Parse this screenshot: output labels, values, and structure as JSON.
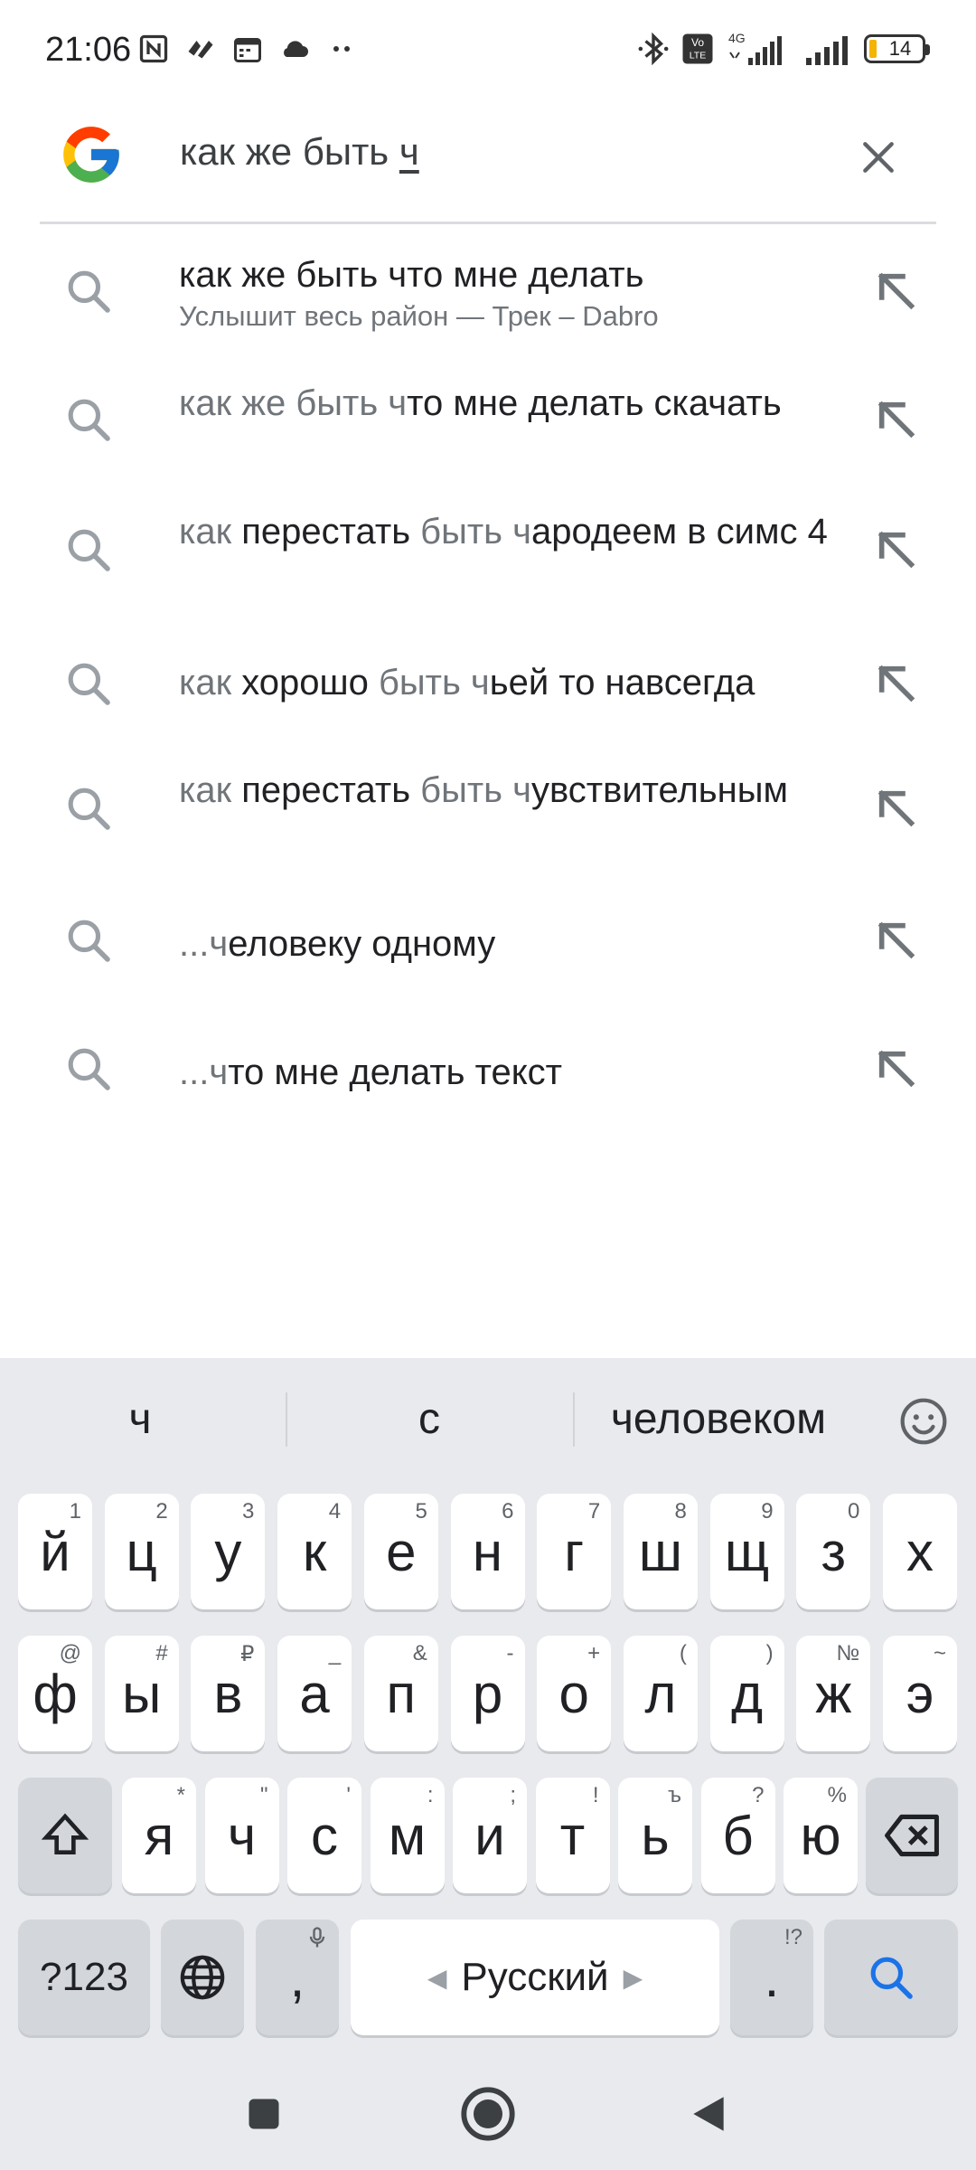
{
  "status_bar": {
    "time": "21:06",
    "network": "4G",
    "volte": "Vo LTE",
    "battery": "14",
    "icons": [
      "nfc-icon",
      "activity-icon",
      "calendar-icon",
      "cloud-icon",
      "more-dots-icon",
      "bluetooth-icon",
      "volte-icon",
      "signal-icon",
      "signal-icon",
      "battery-icon"
    ]
  },
  "search": {
    "query_prefix": "как же быть ",
    "query_typed": "ч",
    "clear_icon": "close-icon"
  },
  "suggestions": [
    {
      "parts": [
        {
          "t": "как же быть что мне делать",
          "muted": false
        }
      ],
      "subtitle": "Услышит весь район — Трек – Dabro"
    },
    {
      "parts": [
        {
          "t": "как же быть ч",
          "muted": true
        },
        {
          "t": "то мне делать скачать",
          "muted": false
        }
      ],
      "subtitle": ""
    },
    {
      "parts": [
        {
          "t": "как ",
          "muted": true
        },
        {
          "t": "перестать ",
          "muted": false
        },
        {
          "t": "быть ч",
          "muted": true
        },
        {
          "t": "ародеем в симс 4",
          "muted": false
        }
      ],
      "subtitle": ""
    },
    {
      "parts": [
        {
          "t": "как ",
          "muted": true
        },
        {
          "t": "хорошо ",
          "muted": false
        },
        {
          "t": "быть ч",
          "muted": true
        },
        {
          "t": "ьей то навсегда",
          "muted": false
        }
      ],
      "subtitle": ""
    },
    {
      "parts": [
        {
          "t": "как ",
          "muted": true
        },
        {
          "t": "перестать ",
          "muted": false
        },
        {
          "t": "быть ч",
          "muted": true
        },
        {
          "t": "увствительным",
          "muted": false
        }
      ],
      "subtitle": ""
    },
    {
      "parts": [
        {
          "t": "...ч",
          "muted": true
        },
        {
          "t": "еловеку одному",
          "muted": false
        }
      ],
      "subtitle": ""
    },
    {
      "parts": [
        {
          "t": "...ч",
          "muted": true
        },
        {
          "t": "то мне делать текст",
          "muted": false
        }
      ],
      "subtitle": ""
    }
  ],
  "keyboard": {
    "word_suggestions": [
      "ч",
      "с",
      "человеком"
    ],
    "row1": [
      {
        "k": "й",
        "h": "1"
      },
      {
        "k": "ц",
        "h": "2"
      },
      {
        "k": "у",
        "h": "3"
      },
      {
        "k": "к",
        "h": "4"
      },
      {
        "k": "е",
        "h": "5"
      },
      {
        "k": "н",
        "h": "6"
      },
      {
        "k": "г",
        "h": "7"
      },
      {
        "k": "ш",
        "h": "8"
      },
      {
        "k": "щ",
        "h": "9"
      },
      {
        "k": "з",
        "h": "0"
      },
      {
        "k": "х",
        "h": ""
      }
    ],
    "row2": [
      {
        "k": "ф",
        "h": "@"
      },
      {
        "k": "ы",
        "h": "#"
      },
      {
        "k": "в",
        "h": "₽"
      },
      {
        "k": "а",
        "h": "_"
      },
      {
        "k": "п",
        "h": "&"
      },
      {
        "k": "р",
        "h": "-"
      },
      {
        "k": "о",
        "h": "+"
      },
      {
        "k": "л",
        "h": "("
      },
      {
        "k": "д",
        "h": ")"
      },
      {
        "k": "ж",
        "h": "№"
      },
      {
        "k": "э",
        "h": "~"
      }
    ],
    "row3": [
      {
        "k": "я",
        "h": "*"
      },
      {
        "k": "ч",
        "h": "\""
      },
      {
        "k": "с",
        "h": "'"
      },
      {
        "k": "м",
        "h": ":"
      },
      {
        "k": "и",
        "h": ";"
      },
      {
        "k": "т",
        "h": "!"
      },
      {
        "k": "ь",
        "h": "ъ"
      },
      {
        "k": "б",
        "h": "?"
      },
      {
        "k": "ю",
        "h": "%"
      }
    ],
    "symbols_label": "?123",
    "comma_label": ",",
    "space_label": "Русский",
    "period_label": ".",
    "period_hint": "!?",
    "accent_color": "#1a73e8"
  },
  "nav": {
    "icons": [
      "recents-square-icon",
      "home-circle-icon",
      "back-triangle-icon"
    ]
  }
}
